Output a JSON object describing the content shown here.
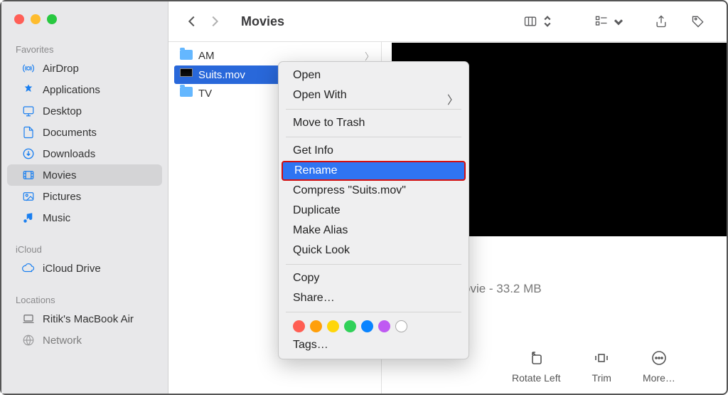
{
  "window_title": "Movies",
  "sidebar": {
    "sections": [
      {
        "label": "Favorites",
        "items": [
          {
            "icon": "airdrop",
            "label": "AirDrop"
          },
          {
            "icon": "applications",
            "label": "Applications"
          },
          {
            "icon": "desktop",
            "label": "Desktop"
          },
          {
            "icon": "documents",
            "label": "Documents"
          },
          {
            "icon": "downloads",
            "label": "Downloads"
          },
          {
            "icon": "movies",
            "label": "Movies",
            "active": true
          },
          {
            "icon": "pictures",
            "label": "Pictures"
          },
          {
            "icon": "music",
            "label": "Music"
          }
        ]
      },
      {
        "label": "iCloud",
        "items": [
          {
            "icon": "icloud",
            "label": "iCloud Drive"
          }
        ]
      },
      {
        "label": "Locations",
        "items": [
          {
            "icon": "laptop",
            "label": "Ritik's MacBook Air"
          },
          {
            "icon": "network",
            "label": "Network"
          }
        ]
      }
    ]
  },
  "files": [
    {
      "type": "folder",
      "name": "AM",
      "has_sub": true
    },
    {
      "type": "mov",
      "name": "Suits.mov",
      "selected": true
    },
    {
      "type": "folder",
      "name": "TV"
    }
  ],
  "context_menu": {
    "open": "Open",
    "open_with": "Open With",
    "trash": "Move to Trash",
    "get_info": "Get Info",
    "rename": "Rename",
    "compress": "Compress \"Suits.mov\"",
    "duplicate": "Duplicate",
    "alias": "Make Alias",
    "quick_look": "Quick Look",
    "copy": "Copy",
    "share": "Share…",
    "tags": "Tags…",
    "tag_colors": [
      "#ff5e53",
      "#ff9f0a",
      "#ffd60a",
      "#30d158",
      "#0a84ff",
      "#bf5af2"
    ]
  },
  "preview": {
    "meta": "ovie - 33.2 MB",
    "actions": {
      "rotate": "Rotate Left",
      "trim": "Trim",
      "more": "More…"
    }
  }
}
